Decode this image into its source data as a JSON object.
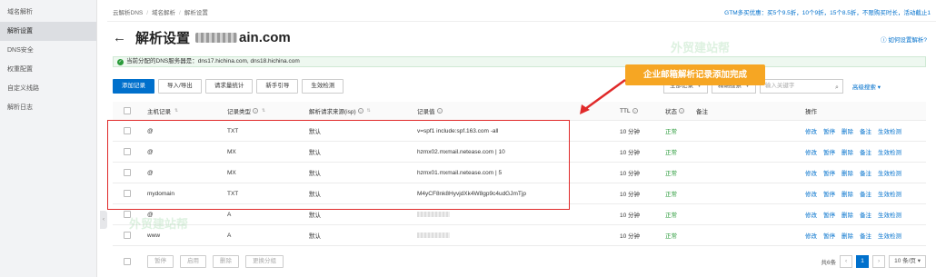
{
  "sidebar": {
    "items": [
      {
        "label": "域名解析",
        "active": false
      },
      {
        "label": "解析设置",
        "active": true
      },
      {
        "label": "DNS安全",
        "active": false
      },
      {
        "label": "权重配置",
        "active": false
      },
      {
        "label": "自定义线路",
        "active": false
      },
      {
        "label": "解析日志",
        "active": false
      }
    ]
  },
  "breadcrumb": [
    "云解析DNS",
    "域名解析",
    "解析设置"
  ],
  "promo_text": "GTM多买优惠：买5个9.5折，10个9折，15个8.5折，不限购买时长，活动截止1",
  "page": {
    "title": "解析设置",
    "domain_suffix": "ain.com",
    "help_link": "如何设置解析?"
  },
  "notice": {
    "text": "当前分配的DNS服务器是：dns17.hichina.com, dns18.hichina.com"
  },
  "toolbar": {
    "buttons": [
      "添加记录",
      "导入/导出",
      "请求量统计",
      "新手引导",
      "生效检测"
    ]
  },
  "filters": {
    "all_records": "全部记录",
    "precise_search": "精确搜索",
    "search_placeholder": "输入关键字",
    "advanced": "高级搜索"
  },
  "callout": "企业邮箱解析记录添加完成",
  "table": {
    "headers": {
      "host": "主机记录",
      "type": "记录类型",
      "line": "解析请求来源(isp)",
      "value": "记录值",
      "ttl": "TTL",
      "status": "状态",
      "remark": "备注",
      "ops": "操作"
    },
    "rows": [
      {
        "host": "@",
        "type": "TXT",
        "line": "默认",
        "value": "v=spf1 include:spf.163.com -all",
        "ttl": "10 分钟",
        "status": "正常"
      },
      {
        "host": "@",
        "type": "MX",
        "line": "默认",
        "value": "hzmx02.mxmail.netease.com | 10",
        "ttl": "10 分钟",
        "status": "正常"
      },
      {
        "host": "@",
        "type": "MX",
        "line": "默认",
        "value": "hzmx01.mxmail.netease.com | 5",
        "ttl": "10 分钟",
        "status": "正常"
      },
      {
        "host": "mydomain",
        "type": "TXT",
        "line": "默认",
        "value": "M4yCF8nk8HyvjdXk4W8gp9c4udGJmTjp",
        "ttl": "10 分钟",
        "status": "正常"
      },
      {
        "host": "@",
        "type": "A",
        "line": "默认",
        "value": "",
        "ttl": "10 分钟",
        "status": "正常"
      },
      {
        "host": "www",
        "type": "A",
        "line": "默认",
        "value": "",
        "ttl": "10 分钟",
        "status": "正常"
      }
    ],
    "ops": [
      "修改",
      "暂停",
      "删除",
      "备注",
      "生效检测"
    ]
  },
  "footer": {
    "buttons": [
      "暂停",
      "启用",
      "删除",
      "更换分组"
    ],
    "total": "共6条",
    "current_page": "1",
    "page_size": "10 条/页"
  },
  "watermark": "外贸建站帮"
}
